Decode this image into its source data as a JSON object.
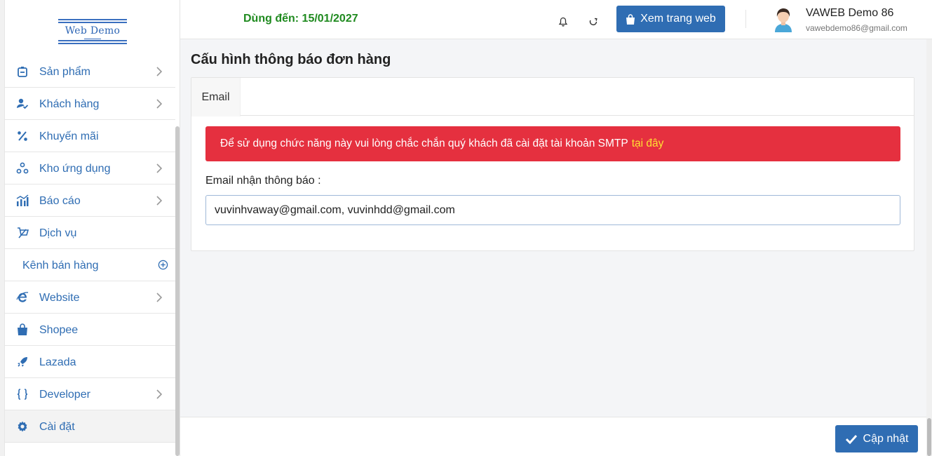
{
  "logo": {
    "text": "Web Demo"
  },
  "header": {
    "expiry": "Dùng đến: 15/01/2027",
    "view_site_label": "Xem trang web",
    "user_name": "VAWEB Demo 86",
    "user_email": "vawebdemo86@gmail.com"
  },
  "sidebar": {
    "items": [
      {
        "label": "Sản phẩm",
        "icon": "product-box-icon"
      },
      {
        "label": "Khách hàng",
        "icon": "customer-check-icon"
      },
      {
        "label": "Khuyến mãi",
        "icon": "percent-icon"
      },
      {
        "label": "Kho ứng dụng",
        "icon": "apps-icon"
      },
      {
        "label": "Báo cáo",
        "icon": "report-chart-icon"
      },
      {
        "label": "Dịch vụ",
        "icon": "service-icon"
      },
      {
        "label": "Kênh bán hàng",
        "icon": "plus-circle-icon"
      },
      {
        "label": "Website",
        "icon": "ie-browser-icon"
      },
      {
        "label": "Shopee",
        "icon": "shopping-bag-icon"
      },
      {
        "label": "Lazada",
        "icon": "rocket-icon"
      },
      {
        "label": "Developer",
        "icon": "braces-icon"
      },
      {
        "label": "Cài đặt",
        "icon": "gear-icon"
      }
    ]
  },
  "main": {
    "title": "Cấu hình thông báo đơn hàng",
    "tab_email": "Email",
    "alert_text": "Để sử dụng chức năng này vui lòng chắc chắn quý khách đã cài đặt tài khoản SMTP",
    "alert_link": "tại đây",
    "email_label": "Email nhận thông báo :",
    "email_value": "vuvinhvaway@gmail.com, vuvinhdd@gmail.com"
  },
  "footer": {
    "save_label": "Cập nhật"
  },
  "colors": {
    "primary": "#2f6db3",
    "danger": "#e5303f",
    "success": "#1f8a1f",
    "link_highlight": "#ffe033"
  }
}
